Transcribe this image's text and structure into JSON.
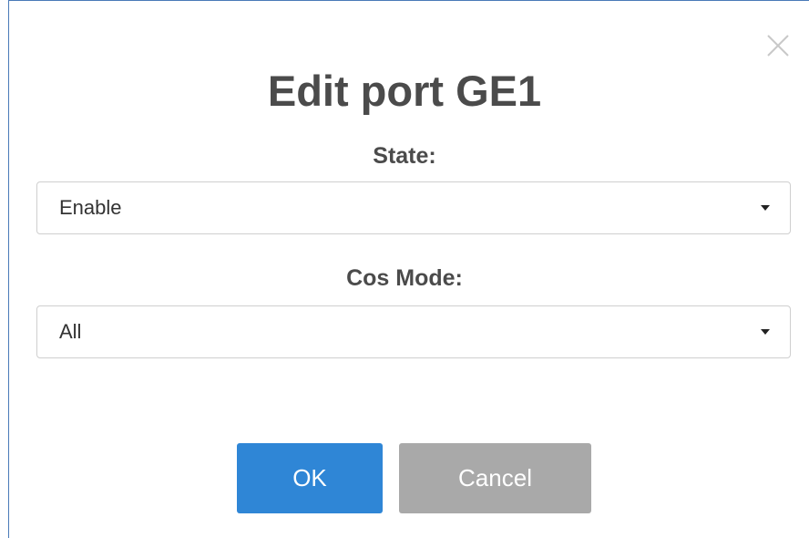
{
  "dialog": {
    "title": "Edit port GE1",
    "close_icon": "close-icon"
  },
  "fields": {
    "state": {
      "label": "State:",
      "value": "Enable"
    },
    "cos_mode": {
      "label": "Cos Mode:",
      "value": "All"
    }
  },
  "buttons": {
    "ok_label": "OK",
    "cancel_label": "Cancel"
  },
  "colors": {
    "ok_button": "#2f86d6",
    "cancel_button": "#a9a9a9",
    "dialog_border": "#4a7ab8",
    "title_text": "#4b4b4b"
  }
}
